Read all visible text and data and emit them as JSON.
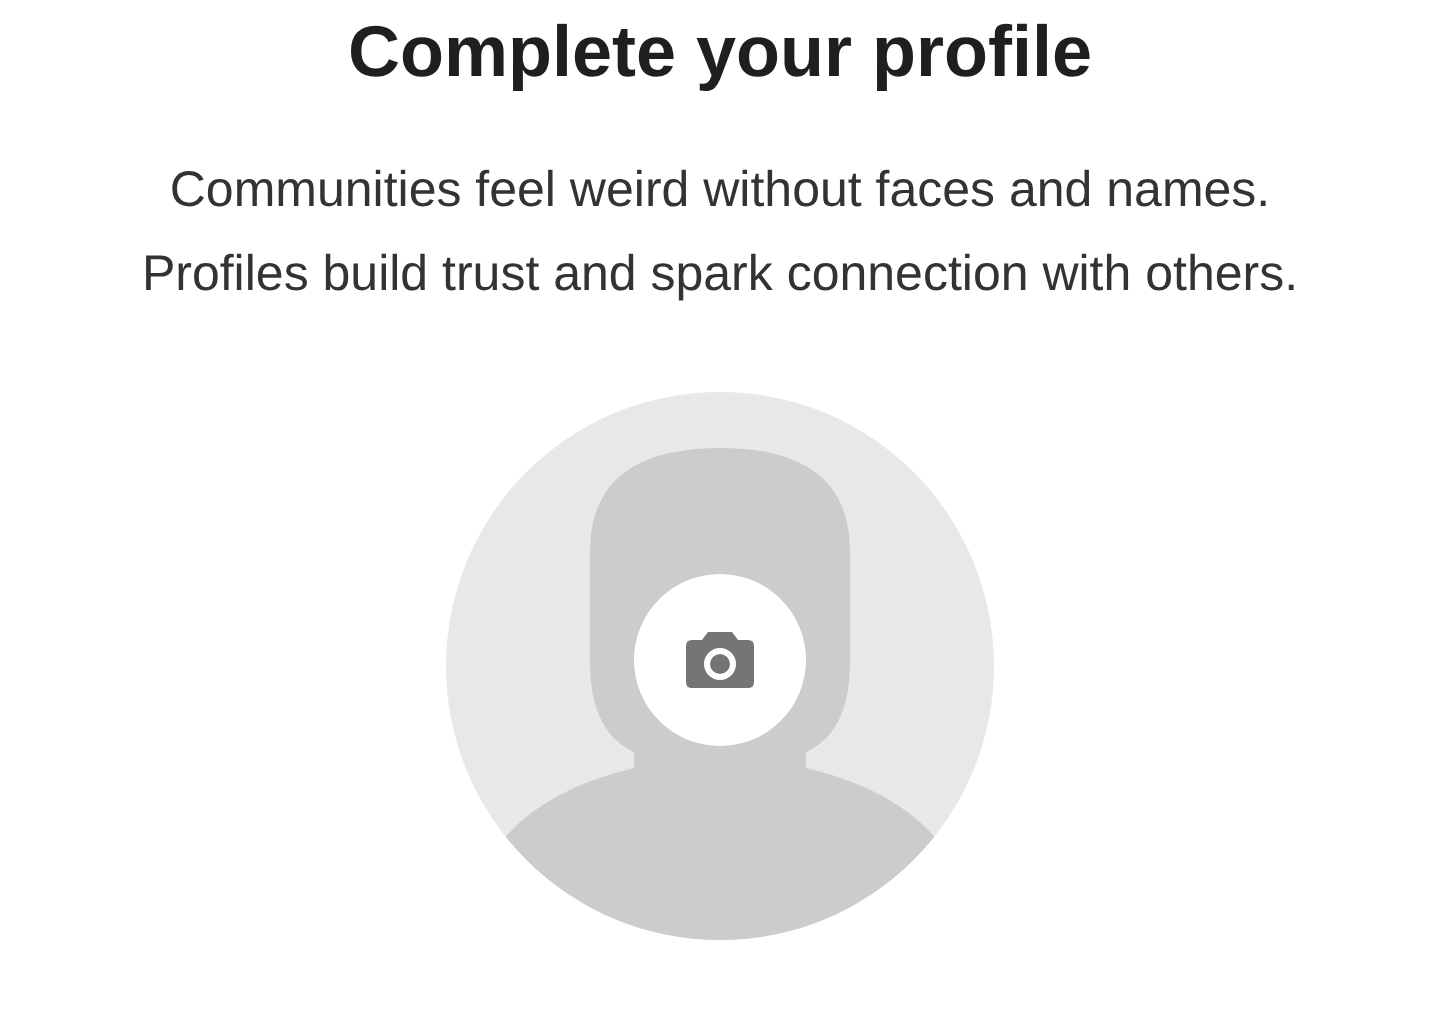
{
  "title": "Complete your profile",
  "description": [
    "Communities feel weird without faces and names.",
    "Profiles build trust and spark connection with others."
  ]
}
